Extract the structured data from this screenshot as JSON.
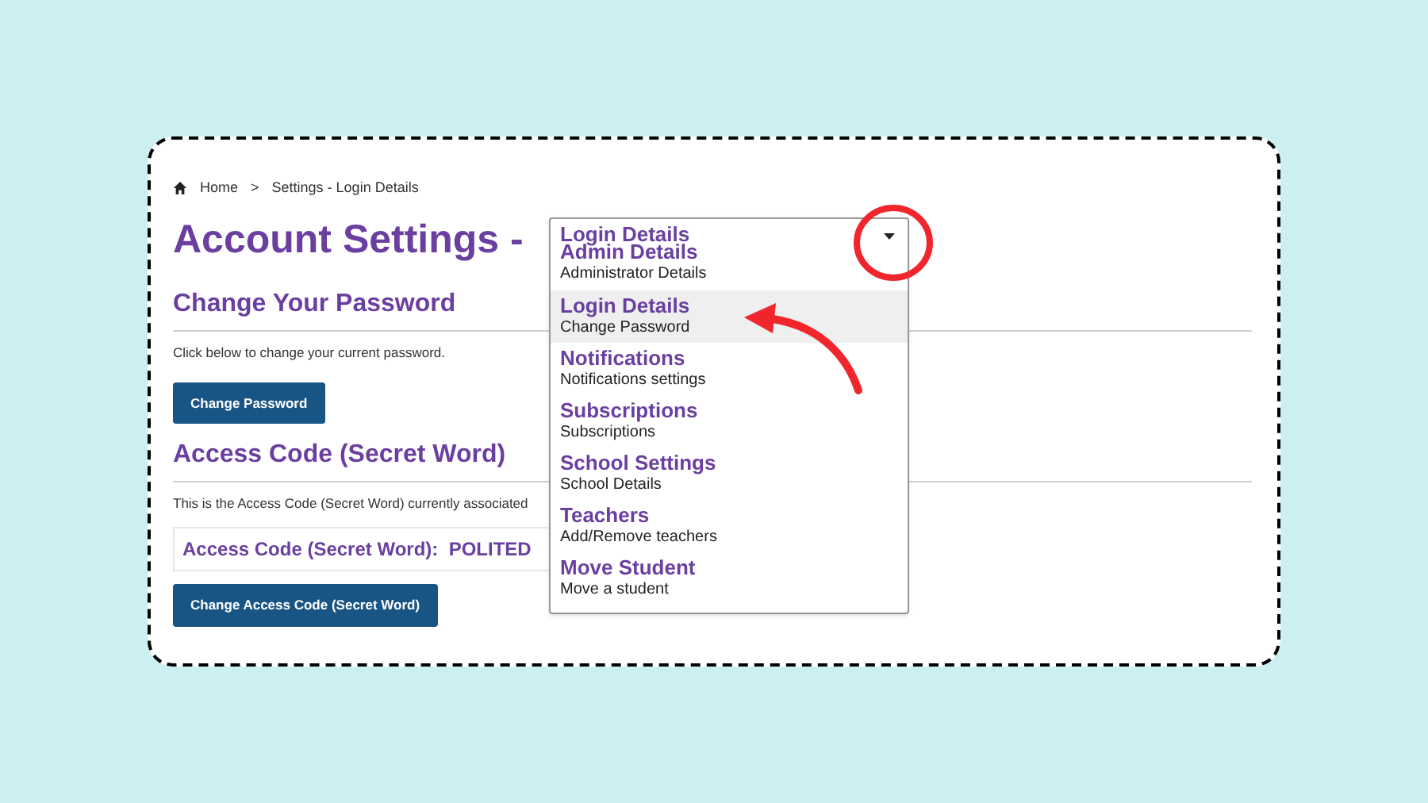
{
  "breadcrumb": {
    "home": "Home",
    "separator": ">",
    "current": "Settings - Login Details"
  },
  "title": "Account Settings -",
  "sections": [
    {
      "heading": "Change Your Password",
      "text": "Click below to change your current password.",
      "button": "Change Password"
    },
    {
      "heading": "Access Code (Secret Word)",
      "text": "This is the Access Code (Secret Word) currently associated",
      "field": "Access Code (Secret Word):  POLITED",
      "button": "Change Access Code (Secret Word)"
    }
  ],
  "dropdown": {
    "value": "Login Details",
    "expanded": true,
    "options": [
      {
        "label": "Admin Details",
        "sub": "Administrator Details",
        "selected": false
      },
      {
        "label": "Login Details",
        "sub": "Change Password",
        "selected": true
      },
      {
        "label": "Notifications",
        "sub": "Notifications settings",
        "selected": false
      },
      {
        "label": "Subscriptions",
        "sub": "Subscriptions",
        "selected": false
      },
      {
        "label": "School Settings",
        "sub": "School Details",
        "selected": false
      },
      {
        "label": "Teachers",
        "sub": "Add/Remove teachers",
        "selected": false
      },
      {
        "label": "Move Student",
        "sub": "Move a student",
        "selected": false
      }
    ]
  }
}
